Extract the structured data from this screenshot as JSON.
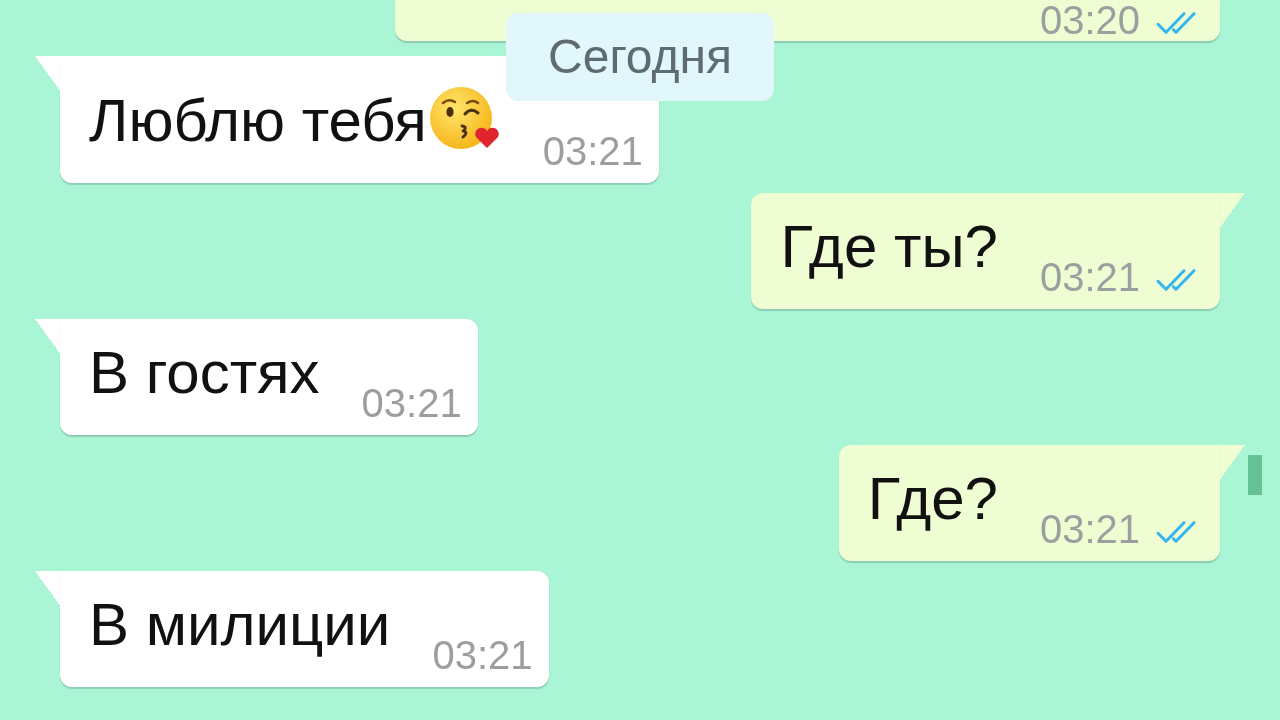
{
  "chat": {
    "items": [
      {
        "kind": "outgoing",
        "time": "03:20",
        "read": true
      },
      {
        "kind": "date",
        "label": "Сегодня"
      },
      {
        "kind": "incoming",
        "text": "Люблю тебя",
        "has_emoji": true,
        "time": "03:21"
      },
      {
        "kind": "outgoing",
        "text": "Где ты?",
        "time": "03:21",
        "read": true
      },
      {
        "kind": "incoming",
        "text": "В гостях",
        "time": "03:21"
      },
      {
        "kind": "outgoing",
        "text": "Где?",
        "time": "03:21",
        "read": true
      },
      {
        "kind": "incoming",
        "text": "В милиции",
        "time": "03:21"
      }
    ]
  }
}
